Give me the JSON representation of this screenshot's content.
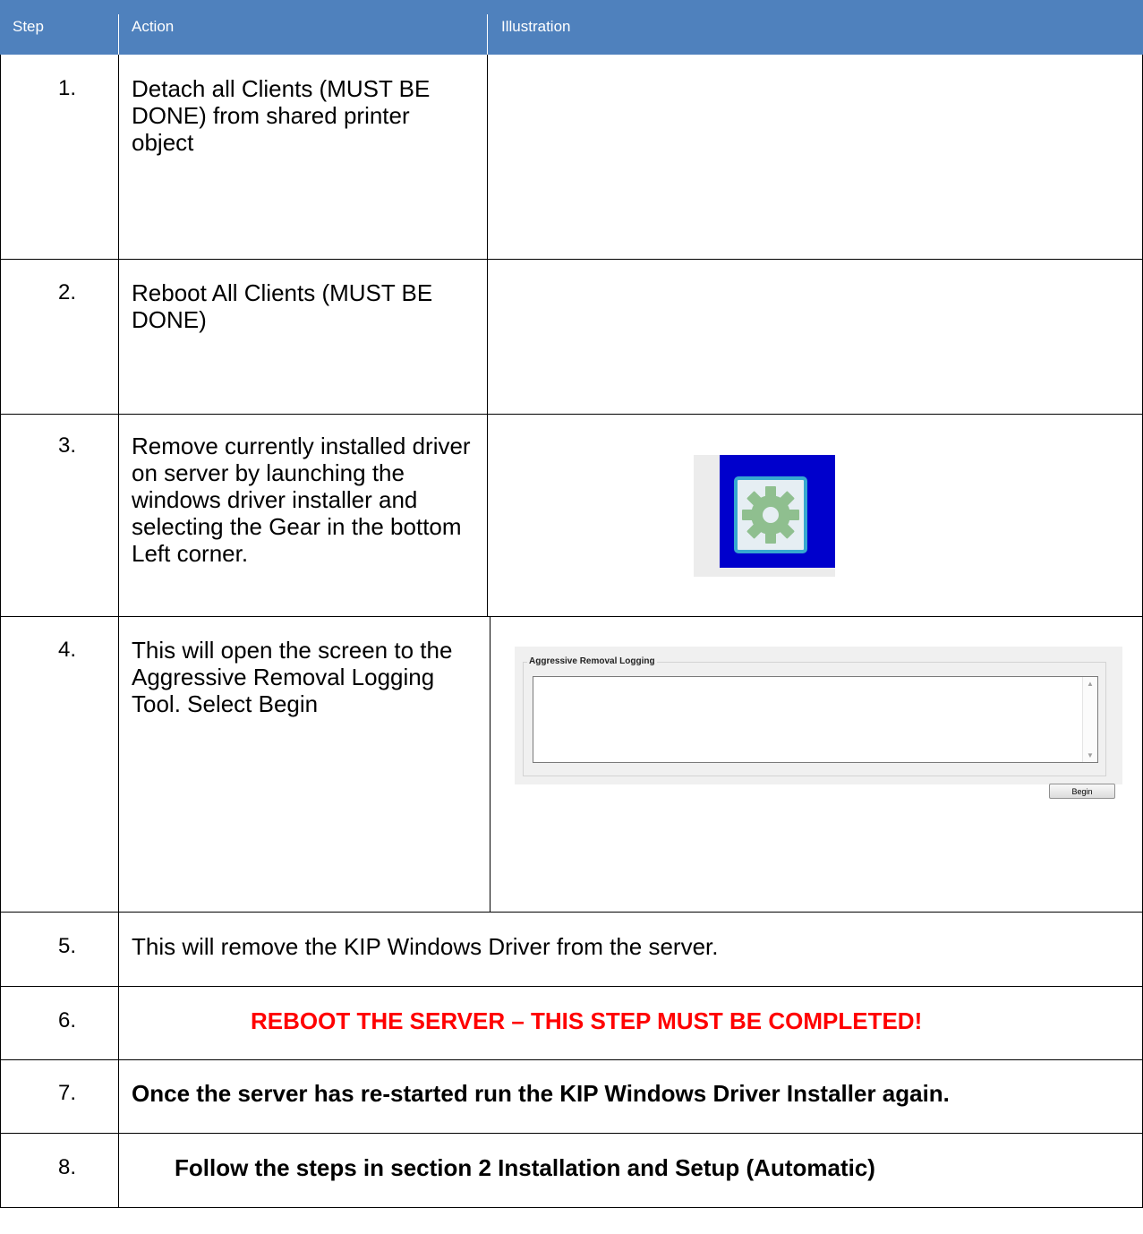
{
  "table": {
    "headers": {
      "step": "Step",
      "action": "Action",
      "illustration": "Illustration"
    },
    "rows": [
      {
        "step": "1.",
        "action": "Detach all Clients (MUST BE DONE) from shared printer object"
      },
      {
        "step": "2.",
        "action": "Reboot All Clients (MUST BE DONE)"
      },
      {
        "step": "3.",
        "action": "Remove currently installed driver on server by launching the windows driver installer and selecting the Gear in the bottom Left corner."
      },
      {
        "step": "4.",
        "action": "This will open the screen to the Aggressive Removal Logging Tool. Select Begin"
      },
      {
        "step": "5.",
        "action": "This will remove the KIP Windows Driver from the server."
      },
      {
        "step": "6.",
        "action": "REBOOT THE SERVER – THIS STEP MUST BE COMPLETED!"
      },
      {
        "step": "7.",
        "action": "Once the server has re-started run the KIP Windows Driver Installer again."
      },
      {
        "step": "8.",
        "action": "Follow the steps in section 2 Installation and Setup (Automatic)"
      }
    ]
  },
  "illustrations": {
    "gear": {
      "icon": "gear-icon",
      "background_color": "#0000cc",
      "gear_color": "#8fbf8f"
    },
    "aggressive_removal": {
      "group_title": "Aggressive Removal Logging",
      "begin_label": "Begin"
    }
  },
  "colors": {
    "header_bg": "#4f81bd",
    "warning_text": "#ff0000"
  }
}
